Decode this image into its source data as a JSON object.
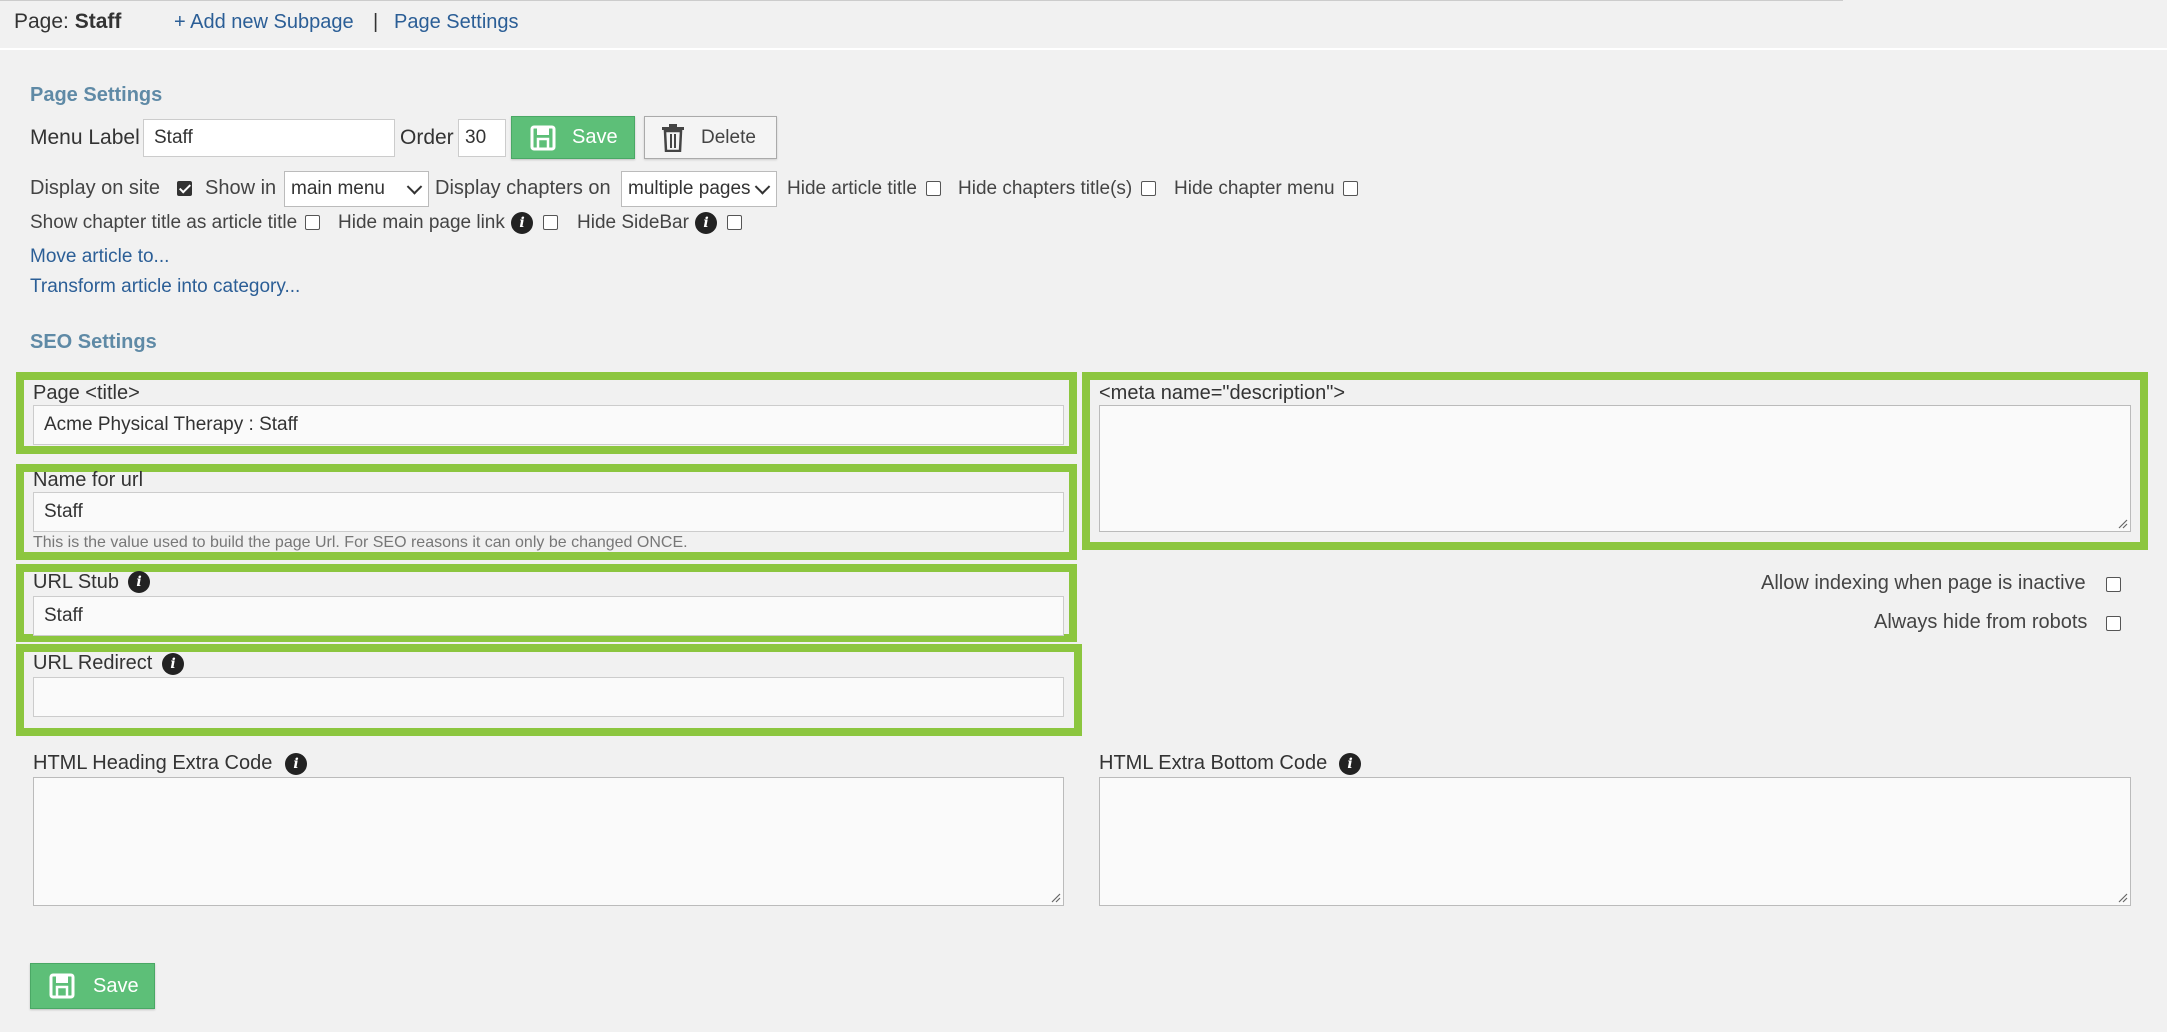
{
  "header": {
    "page_prefix": "Page:",
    "page_name": "Staff",
    "add_subpage": "+ Add new Subpage",
    "separator": "|",
    "page_settings_link": "Page Settings"
  },
  "page_settings": {
    "title": "Page Settings",
    "menu_label_label": "Menu Label",
    "menu_label_value": "Staff",
    "order_label": "Order",
    "order_value": "30",
    "save_label": "Save",
    "delete_label": "Delete",
    "display_on_site_label": "Display on site",
    "display_on_site_checked": true,
    "show_in_label": "Show in",
    "show_in_value": "main menu",
    "display_chapters_label": "Display chapters on",
    "display_chapters_value": "multiple pages",
    "hide_article_title_label": "Hide article title",
    "hide_chapters_title_label": "Hide chapters title(s)",
    "hide_chapter_menu_label": "Hide chapter menu",
    "show_chapter_title_label": "Show chapter title as article title",
    "hide_main_page_link_label": "Hide main page link",
    "hide_sidebar_label": "Hide SideBar",
    "move_article_link": "Move article to...",
    "transform_link": "Transform article into category..."
  },
  "seo": {
    "title": "SEO Settings",
    "page_title_label": "Page <title>",
    "page_title_value": "Acme Physical Therapy : Staff",
    "meta_description_label": "<meta name=\"description\">",
    "name_for_url_label": "Name for url",
    "name_for_url_value": "Staff",
    "name_for_url_help": "This is the value used to build the page Url. For SEO reasons it can only be changed ONCE.",
    "url_stub_label": "URL Stub",
    "url_stub_value": "Staff",
    "url_redirect_label": "URL Redirect",
    "url_redirect_value": "",
    "allow_indexing_label": "Allow indexing when page is inactive",
    "always_hide_label": "Always hide from robots",
    "html_heading_label": "HTML Heading Extra Code",
    "html_bottom_label": "HTML Extra Bottom Code"
  },
  "footer": {
    "save_label": "Save"
  },
  "colors": {
    "accent_green": "#8cc63f",
    "save_green": "#5dbf78",
    "link_blue": "#2b5e96",
    "section_title": "#5f8aa6"
  },
  "icons": {
    "save": "floppy-disk-icon",
    "delete": "trash-icon",
    "info": "info-icon"
  }
}
